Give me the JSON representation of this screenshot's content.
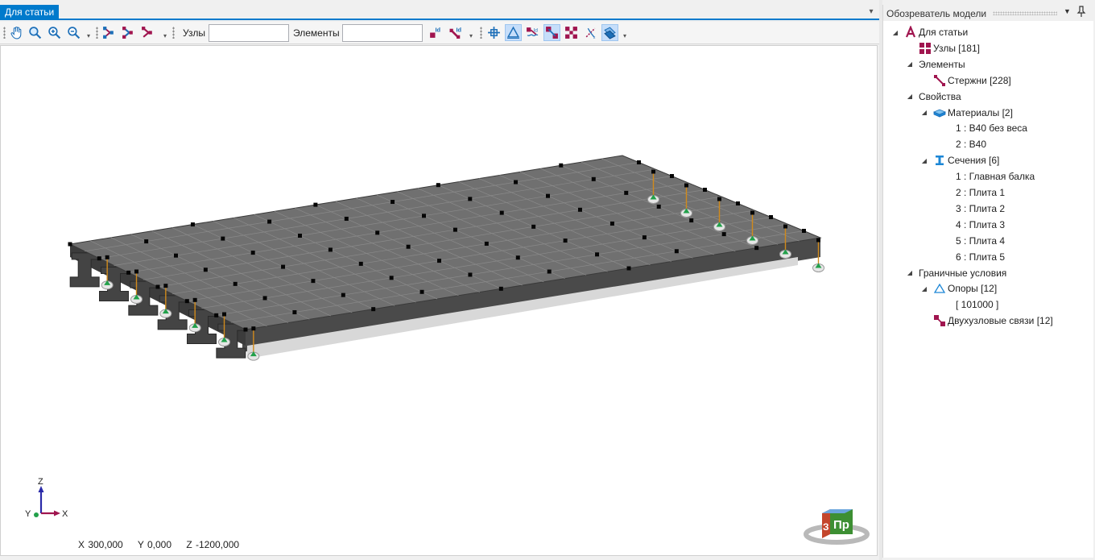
{
  "document": {
    "tab_title": "Для статьи",
    "tab_menu_icon": "chevron-down-icon"
  },
  "toolbar": {
    "nodes_label": "Узлы",
    "nodes_value": "",
    "elements_label": "Элементы",
    "elements_value": "",
    "buttons": [
      "pan-hand-icon",
      "zoom-fit-icon",
      "zoom-in-icon",
      "zoom-out-icon",
      "select-nodes-icon",
      "select-elements-icon",
      "select-both-icon",
      "node-id-icon",
      "element-id-icon",
      "center-axes-icon",
      "supports-icon",
      "links-icon",
      "node-markers-icon",
      "element-markers-icon",
      "local-axes-icon",
      "section-view-icon"
    ]
  },
  "viewport": {
    "coords": {
      "x": "X 300,000",
      "y": "Y 0,000",
      "z": "Z -1200,000"
    },
    "axes": {
      "z": "Z",
      "y": "Y",
      "x": "X"
    },
    "view_cube": {
      "front": "Пр",
      "left": "З"
    }
  },
  "explorer": {
    "title": "Обозреватель модели",
    "tree": [
      {
        "level": 0,
        "expander": "◢",
        "icon": "model-icon",
        "label": "Для статьи"
      },
      {
        "level": 1,
        "expander": "",
        "icon": "nodes-icon",
        "label": "Узлы [181]"
      },
      {
        "level": 1,
        "expander": "◢",
        "icon": "",
        "label": "Элементы"
      },
      {
        "level": 2,
        "expander": "",
        "icon": "bars-icon",
        "label": "Стержни [228]"
      },
      {
        "level": 1,
        "expander": "◢",
        "icon": "",
        "label": "Свойства"
      },
      {
        "level": 2,
        "expander": "◢",
        "icon": "materials-icon",
        "label": "Материалы [2]"
      },
      {
        "level": 3,
        "expander": "",
        "icon": "",
        "label": "1 : B40 без веса"
      },
      {
        "level": 3,
        "expander": "",
        "icon": "",
        "label": "2 : B40"
      },
      {
        "level": 2,
        "expander": "◢",
        "icon": "sections-icon",
        "label": "Сечения [6]"
      },
      {
        "level": 3,
        "expander": "",
        "icon": "",
        "label": "1 : Главная балка"
      },
      {
        "level": 3,
        "expander": "",
        "icon": "",
        "label": "2 : Плита 1"
      },
      {
        "level": 3,
        "expander": "",
        "icon": "",
        "label": "3 : Плита 2"
      },
      {
        "level": 3,
        "expander": "",
        "icon": "",
        "label": "4 : Плита 3"
      },
      {
        "level": 3,
        "expander": "",
        "icon": "",
        "label": "5 : Плита 4"
      },
      {
        "level": 3,
        "expander": "",
        "icon": "",
        "label": "6 : Плита 5"
      },
      {
        "level": 1,
        "expander": "◢",
        "icon": "",
        "label": "Граничные условия"
      },
      {
        "level": 2,
        "expander": "◢",
        "icon": "supports-icon",
        "label": "Опоры [12]"
      },
      {
        "level": 3,
        "expander": "",
        "icon": "",
        "label": "[ 101000 ]"
      },
      {
        "level": 2,
        "expander": "",
        "icon": "links-icon",
        "label": "Двухузловые связи [12]"
      }
    ]
  },
  "colors": {
    "accent": "#007acc",
    "model_magenta": "#a0154f",
    "deck_gray": "#6e6e6e",
    "support_green": "#22a04a",
    "link_orange": "#d08a1c"
  }
}
